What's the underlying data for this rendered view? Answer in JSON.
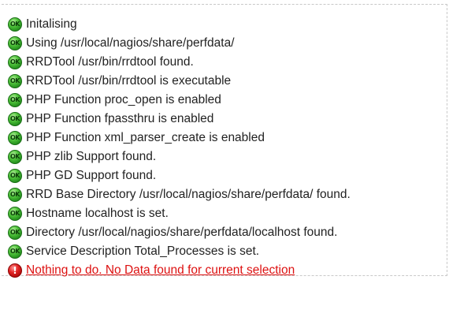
{
  "checks": [
    {
      "status": "ok",
      "icon": "ok-icon",
      "badge": "OK",
      "text": "Initalising"
    },
    {
      "status": "ok",
      "icon": "ok-icon",
      "badge": "OK",
      "text": "Using /usr/local/nagios/share/perfdata/"
    },
    {
      "status": "ok",
      "icon": "ok-icon",
      "badge": "OK",
      "text": "RRDTool /usr/bin/rrdtool found."
    },
    {
      "status": "ok",
      "icon": "ok-icon",
      "badge": "OK",
      "text": "RRDTool /usr/bin/rrdtool is executable"
    },
    {
      "status": "ok",
      "icon": "ok-icon",
      "badge": "OK",
      "text": "PHP Function proc_open is enabled"
    },
    {
      "status": "ok",
      "icon": "ok-icon",
      "badge": "OK",
      "text": "PHP Function fpassthru is enabled"
    },
    {
      "status": "ok",
      "icon": "ok-icon",
      "badge": "OK",
      "text": "PHP Function xml_parser_create is enabled"
    },
    {
      "status": "ok",
      "icon": "ok-icon",
      "badge": "OK",
      "text": "PHP zlib Support found."
    },
    {
      "status": "ok",
      "icon": "ok-icon",
      "badge": "OK",
      "text": "PHP GD Support found."
    },
    {
      "status": "ok",
      "icon": "ok-icon",
      "badge": "OK",
      "text": "RRD Base Directory /usr/local/nagios/share/perfdata/ found."
    },
    {
      "status": "ok",
      "icon": "ok-icon",
      "badge": "OK",
      "text": "Hostname localhost is set."
    },
    {
      "status": "ok",
      "icon": "ok-icon",
      "badge": "OK",
      "text": "Directory /usr/local/nagios/share/perfdata/localhost found."
    },
    {
      "status": "ok",
      "icon": "ok-icon",
      "badge": "OK",
      "text": "Service Description Total_Processes is set."
    }
  ],
  "error": {
    "status": "error",
    "icon": "error-icon",
    "badge": "!",
    "text": "Nothing to do. No Data found for current selection"
  },
  "colors": {
    "ok": "#2ea324",
    "error": "#dd1111",
    "text": "#222222",
    "border": "#c8c8c8"
  }
}
